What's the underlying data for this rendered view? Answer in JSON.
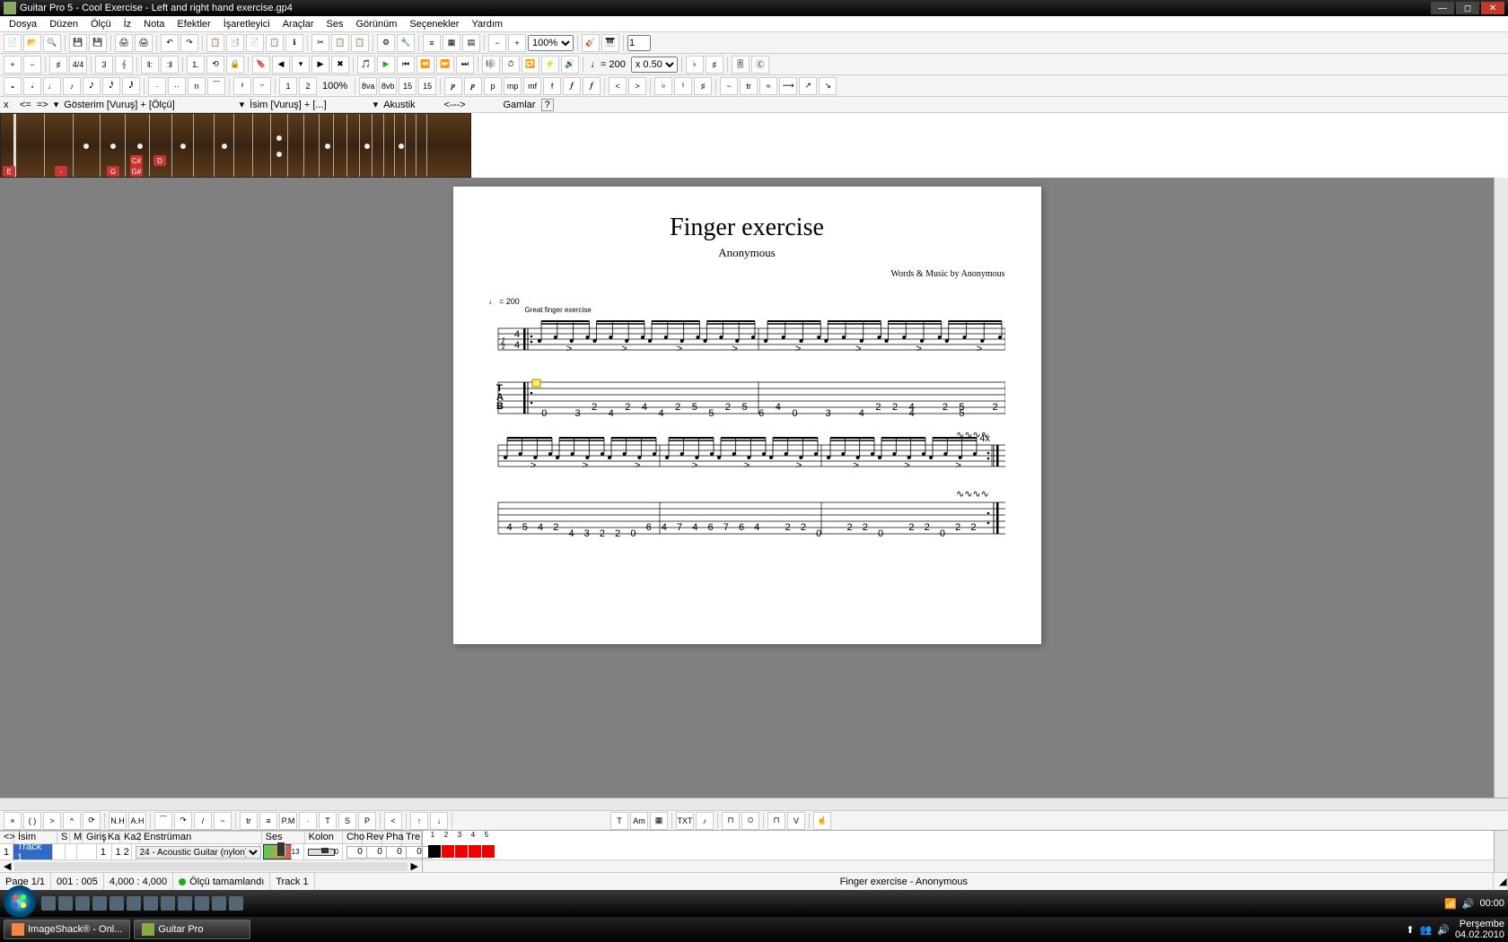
{
  "titlebar": {
    "title": "Guitar Pro 5 - Cool Exercise - Left and right hand exercise.gp4"
  },
  "menu": [
    "Dosya",
    "Düzen",
    "Ölçü",
    "İz",
    "Nota",
    "Efektler",
    "İşaretleyici",
    "Araçlar",
    "Ses",
    "Görünüm",
    "Seçenekler",
    "Yardım"
  ],
  "zoom": "100%",
  "tempo": "♩= 200",
  "tempo_mult": "x 0.50",
  "fret": {
    "close": "x",
    "prev": "<=",
    "next": "=>",
    "view_label": "Gösterim [Vuruş] + [Ölçü]",
    "name_label": "İsim [Vuruş] + [...]",
    "tuning": "Akustik",
    "nav": "<--->",
    "scales": "Gamlar",
    "help": "?"
  },
  "score": {
    "title": "Finger exercise",
    "author": "Anonymous",
    "credits": "Words & Music by Anonymous",
    "tempo_mark": "♩ = 200",
    "subtitle": "Great finger exercise",
    "repeat": "4x",
    "tab1": [
      [
        null,
        null,
        null,
        "2",
        null,
        "2",
        "4",
        null,
        "2",
        "5",
        null,
        "2",
        "5",
        null,
        "4",
        null,
        null,
        null,
        null,
        null,
        "2",
        "2",
        "4",
        null,
        "2",
        "5",
        null,
        "2"
      ],
      [
        "0",
        null,
        "3",
        null,
        "4",
        null,
        null,
        "4",
        null,
        null,
        "5",
        null,
        null,
        "6",
        null,
        "0",
        null,
        "3",
        null,
        "4",
        null,
        null,
        "4",
        null,
        null,
        "5",
        null,
        null
      ]
    ],
    "tab2": [
      [
        "4",
        "5",
        "4",
        "2",
        null,
        null,
        null,
        null,
        null,
        "6",
        "4",
        "7",
        "4",
        "6",
        "7",
        "6",
        "4",
        null,
        "2",
        "2",
        null,
        null,
        "2",
        "2",
        null,
        null,
        "2",
        "2",
        null,
        "2",
        "2"
      ],
      [
        null,
        null,
        null,
        null,
        "4",
        "3",
        "2",
        "2",
        "0",
        null,
        null,
        null,
        null,
        null,
        null,
        null,
        null,
        null,
        null,
        null,
        "0",
        null,
        null,
        null,
        "0",
        null,
        null,
        null,
        "0",
        null,
        null
      ]
    ]
  },
  "track_hdr": {
    "id": "",
    "name": "İsim",
    "s": "S",
    "m": "M",
    "in": "Giriş",
    "ka": "Ka",
    "ka2": "Ka2",
    "instr": "Enstrüman",
    "ses": "Ses",
    "kolon": "Kolon",
    "cho": "Cho",
    "rev": "Rev",
    "pha": "Pha",
    "tre": "Tre"
  },
  "track": {
    "num": "1",
    "name": "Track 1",
    "ch1": "1",
    "ch2": "1",
    "ch3": "2",
    "instr": "24 - Acoustic Guitar (nylon)",
    "vol": "13",
    "pan": "0",
    "cho": "0",
    "rev": "0",
    "pha": "0",
    "tre": "0"
  },
  "mixer_nums": [
    "1",
    "2",
    "3",
    "4",
    "5"
  ],
  "status": {
    "page": "Page 1/1",
    "pos": "001 : 005",
    "time": "4,000 : 4,000",
    "msg": "Ölçü tamamlandı",
    "trk": "Track 1",
    "song": "Finger exercise - Anonymous"
  },
  "taskbar": {
    "btn1": "ImageShack® - Onl...",
    "btn2": "Guitar Pro"
  },
  "tray": {
    "time": "00:00",
    "day": "Perşembe",
    "date": "04.02.2010"
  }
}
